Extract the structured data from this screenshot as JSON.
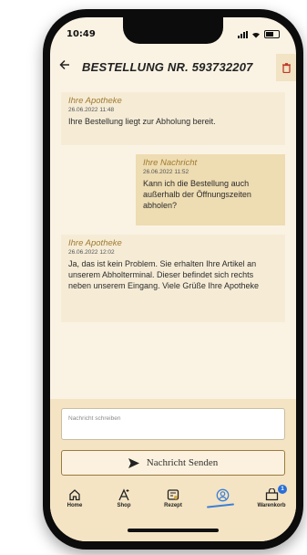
{
  "status": {
    "time": "10:49"
  },
  "header": {
    "title": "BESTELLUNG NR. 593732207"
  },
  "messages": [
    {
      "direction": "in",
      "sender": "Ihre Apotheke",
      "date": "26.06.2022 11:48",
      "text": "Ihre Bestellung liegt zur Abholung bereit."
    },
    {
      "direction": "out",
      "sender": "Ihre Nachricht",
      "date": "26.06.2022 11:52",
      "text": "Kann ich die Bestellung auch außerhalb der Öffnungszeiten abholen?"
    },
    {
      "direction": "in",
      "sender": "Ihre Apotheke",
      "date": "26.06.2022 12:02",
      "text": "Ja, das ist kein Problem. Sie erhalten Ihre Artikel an unserem Abholterminal. Dieser befindet sich rechts neben unserem Eingang. Viele Grüße Ihre Apotheke"
    }
  ],
  "composer": {
    "placeholder": "Nachricht schreiben",
    "send_label": "Nachricht Senden"
  },
  "tabs": [
    {
      "label": "Home",
      "icon": "home-icon"
    },
    {
      "label": "Shop",
      "icon": "shop-icon"
    },
    {
      "label": "Rezept",
      "icon": "prescription-icon"
    },
    {
      "label": "",
      "icon": "profile-icon",
      "active": true
    },
    {
      "label": "Warenkorb",
      "icon": "cart-icon",
      "badge": "1"
    }
  ],
  "colors": {
    "background": "#faf3e4",
    "incoming": "#f6ecd6",
    "outgoing": "#eedcb2",
    "accent": "#a07a30",
    "active_tab": "#3b7fd9"
  }
}
